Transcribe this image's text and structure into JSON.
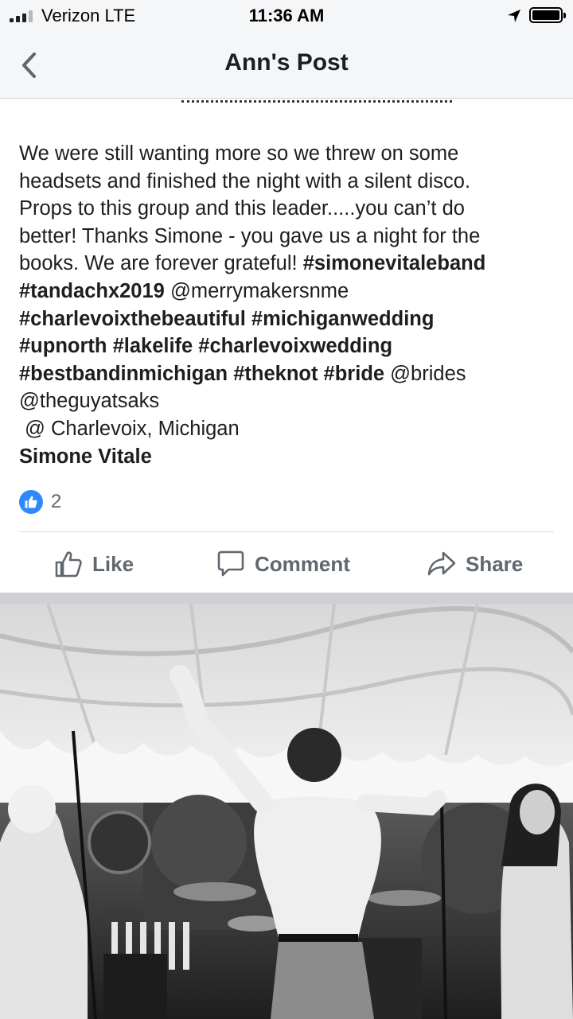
{
  "status_bar": {
    "carrier": "Verizon LTE",
    "time": "11:36 AM",
    "icons": [
      "signal-icon",
      "location-arrow-icon",
      "battery-icon"
    ]
  },
  "nav": {
    "title": "Ann's Post",
    "back_icon": "chevron-left-icon"
  },
  "post": {
    "lines": [
      [
        {
          "t": "We were still wanting more so we threw on some",
          "b": false
        }
      ],
      [
        {
          "t": "headsets and finished the night with a silent disco.",
          "b": false
        }
      ],
      [
        {
          "t": "Props to this group and this leader.....you can’t do",
          "b": false
        }
      ],
      [
        {
          "t": "better! Thanks Simone - you gave us a night for the",
          "b": false
        }
      ],
      [
        {
          "t": "books. We are forever grateful! ",
          "b": false
        },
        {
          "t": "#simonevitaleband",
          "b": true
        }
      ],
      [
        {
          "t": "#tandachx2019",
          "b": true
        },
        {
          "t": " @merrymakersnme",
          "b": false
        }
      ],
      [
        {
          "t": "#charlevoixthebeautiful #michiganwedding",
          "b": true
        }
      ],
      [
        {
          "t": "#upnorth #lakelife #charlevoixwedding",
          "b": true
        }
      ],
      [
        {
          "t": "#bestbandinmichigan #theknot #bride",
          "b": true
        },
        {
          "t": " @brides",
          "b": false
        }
      ],
      [
        {
          "t": "@theguyatsaks",
          "b": false
        }
      ]
    ],
    "location": "@ Charlevoix, Michigan",
    "tagged": "Simone Vitale"
  },
  "reactions": {
    "icon": "thumbs-up-icon",
    "count": "2"
  },
  "actions": {
    "like": "Like",
    "comment": "Comment",
    "share": "Share"
  },
  "photo": {
    "description_icon": "photo-image"
  },
  "colors": {
    "bar_bg": "#f5f6f7",
    "text": "#1c1e21",
    "muted": "#606770",
    "like_blue": "#2e89ff",
    "separator": "#ced0d4"
  }
}
